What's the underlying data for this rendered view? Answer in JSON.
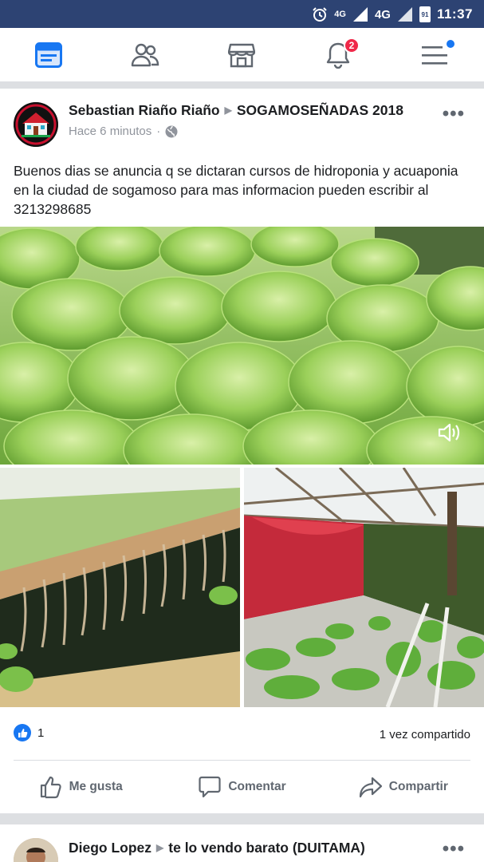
{
  "status_bar": {
    "network_small": "4G",
    "network": "4G",
    "battery": "91",
    "time": "11:37"
  },
  "nav": {
    "items": [
      {
        "name": "news-feed",
        "icon": "news-feed-icon"
      },
      {
        "name": "friends",
        "icon": "friends-icon"
      },
      {
        "name": "marketplace",
        "icon": "marketplace-icon"
      },
      {
        "name": "notifications",
        "icon": "bell-icon",
        "badge": "2"
      },
      {
        "name": "menu",
        "icon": "hamburger-menu-icon"
      }
    ],
    "notification_count": "2",
    "accent_color": "#1877f2"
  },
  "post": {
    "author": "Sebastian Riaño Riaño",
    "group": "SOGAMOSEÑADAS 2018",
    "time": "Hace 6 minutos",
    "privacy_icon": "globe-icon",
    "more": "•••",
    "text": "Buenos dias se anuncia q se dictaran cursos de hidroponia y acuaponia en la ciudad de sogamoso para mas informacion pueden escribir al 3213298685",
    "media": [
      {
        "kind": "video",
        "subject": "lettuce-hydroponics-video",
        "sound_icon": "speaker-icon"
      },
      {
        "kind": "image",
        "subject": "hydroponic-raft-roots"
      },
      {
        "kind": "image",
        "subject": "greenhouse-lettuce-rows"
      }
    ],
    "reaction_count": "1",
    "shares": "1 vez compartido",
    "actions": {
      "like": "Me gusta",
      "comment": "Comentar",
      "share": "Compartir"
    }
  },
  "next_post": {
    "author": "Diego Lopez",
    "group": "te lo vendo barato (DUITAMA)",
    "more": "•••"
  }
}
